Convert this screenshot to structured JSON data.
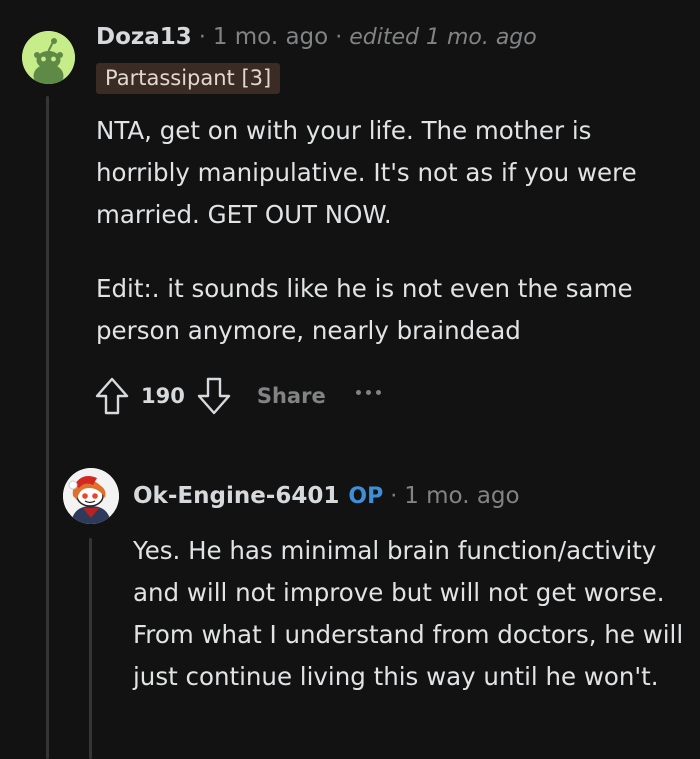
{
  "comment": {
    "author": "Doza13",
    "separator_1": "·",
    "time": "1 mo. ago",
    "separator_2": "·",
    "edited": "edited 1 mo. ago",
    "flair": "Partassipant [3]",
    "paragraph_1": "NTA, get on with your life. The mother is horribly manipulative. It's not as if you were married. GET OUT NOW.",
    "paragraph_2": "Edit:. it sounds like he is not even the same person anymore, nearly braindead",
    "votes": "190",
    "share_label": "Share",
    "upvote_icon": "upvote-arrow-icon",
    "downvote_icon": "downvote-arrow-icon",
    "more_icon": "more-options-icon"
  },
  "reply": {
    "author": "Ok-Engine-6401",
    "op_badge": "OP",
    "separator": "·",
    "time": "1 mo. ago",
    "text": "Yes. He has minimal brain function/activity and will not improve but will not get worse. From what I understand from doctors, he will just continue living this way until he won't."
  },
  "colors": {
    "background": "#121212",
    "text": "#d7dadc",
    "muted": "#818384",
    "op_blue": "#3f8fd8",
    "flair_bg": "#3a2b24"
  }
}
